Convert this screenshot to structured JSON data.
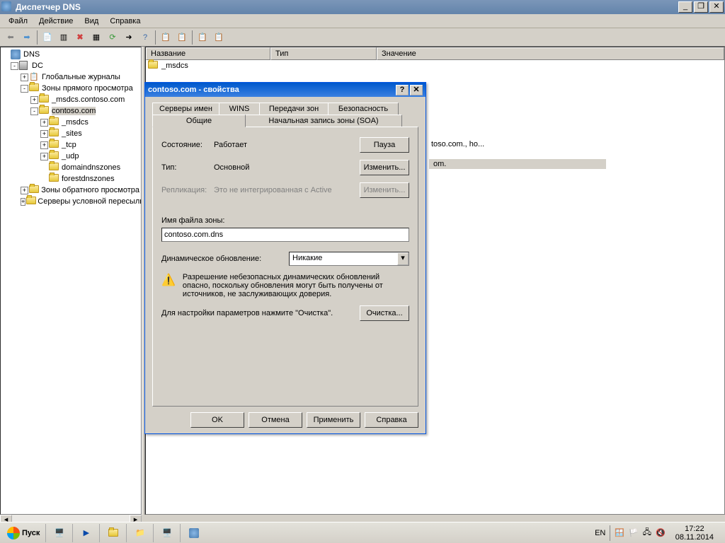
{
  "window": {
    "title": "Диспетчер DNS"
  },
  "menu": {
    "file": "Файл",
    "action": "Действие",
    "view": "Вид",
    "help": "Справка"
  },
  "tree": {
    "root": "DNS",
    "server": "DC",
    "global_logs": "Глобальные журналы",
    "fwd_zones": "Зоны прямого просмотра",
    "msdcs_zone": "_msdcs.contoso.com",
    "contoso": "contoso.com",
    "sub_msdcs": "_msdcs",
    "sub_sites": "_sites",
    "sub_tcp": "_tcp",
    "sub_udp": "_udp",
    "sub_ddz": "domaindnszones",
    "sub_fdz": "forestdnszones",
    "rev_zones": "Зоны обратного просмотра",
    "cond_fwd": "Серверы условной пересылки"
  },
  "list": {
    "col_name": "Название",
    "col_type": "Тип",
    "col_value": "Значение",
    "r_msdcs": "_msdcs",
    "r_row2a": "toso.com., ho...",
    "r_row2b": "om."
  },
  "dialog": {
    "title": "contoso.com - свойства",
    "tabs": {
      "ns": "Серверы имен",
      "wins": "WINS",
      "transfer": "Передачи зон",
      "security": "Безопасность",
      "general": "Общие",
      "soa": "Начальная запись зоны (SOA)"
    },
    "state_lbl": "Состояние:",
    "state_val": "Работает",
    "pause": "Пауза",
    "type_lbl": "Тип:",
    "type_val": "Основной",
    "change": "Изменить...",
    "repl_lbl": "Репликация:",
    "repl_val": "Это не интегрированная с Active",
    "zonefile_lbl": "Имя файла зоны:",
    "zonefile_val": "contoso.com.dns",
    "dynupd_lbl": "Динамическое обновление:",
    "dynupd_val": "Никакие",
    "warning": "Разрешение небезопасных динамических обновлений опасно, поскольку обновления могут быть получены от источников, не заслуживающих доверия.",
    "scavenge_hint": "Для настройки параметров нажмите \"Очистка\".",
    "scavenge": "Очистка...",
    "ok": "OK",
    "cancel": "Отмена",
    "apply": "Применить",
    "help": "Справка"
  },
  "taskbar": {
    "start": "Пуск",
    "lang": "EN",
    "time": "17:22",
    "date": "08.11.2014"
  }
}
